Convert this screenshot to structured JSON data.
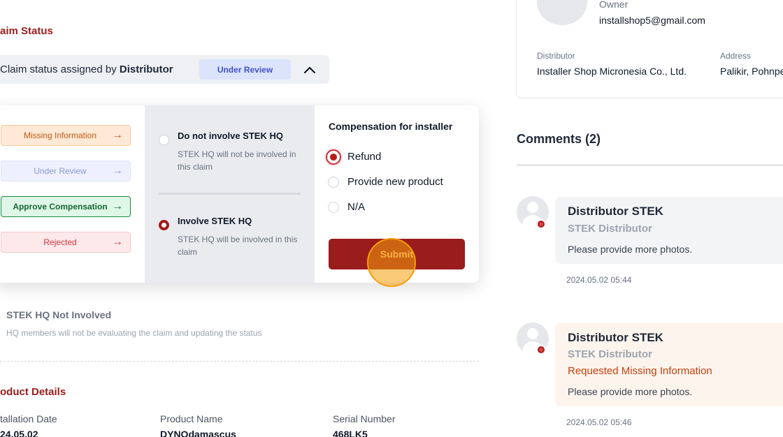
{
  "claim_status": {
    "section_title": "aim Status",
    "assigned_prefix": "Claim status assigned by ",
    "assigned_by": "Distributor",
    "current_status": "Under Review"
  },
  "status_options": [
    {
      "label": "Missing Information"
    },
    {
      "label": "Under Review"
    },
    {
      "label": "Approve Compensation"
    },
    {
      "label": "Rejected"
    }
  ],
  "hq_options": [
    {
      "title": "Do not involve STEK HQ",
      "desc": "STEK HQ will not be involved in this claim",
      "selected": false
    },
    {
      "title": "Involve STEK HQ",
      "desc": "STEK HQ will be involved in this claim",
      "selected": true
    }
  ],
  "compensation": {
    "title": "Compensation for installer",
    "options": [
      {
        "label": "Refund",
        "selected": true
      },
      {
        "label": "Provide new product",
        "selected": false
      },
      {
        "label": "N/A",
        "selected": false
      }
    ],
    "submit_label": "Submit"
  },
  "hq_status": {
    "title": "STEK HQ Not Involved",
    "desc": "HQ members will not be evaluating the claim and updating the status"
  },
  "product_details": {
    "title": "oduct Details",
    "columns": [
      {
        "label": "tallation Date",
        "value": "24.05.02"
      },
      {
        "label": "Product Name",
        "value": "DYNOdamascus"
      },
      {
        "label": "Serial Number",
        "value": "468LK5"
      }
    ]
  },
  "owner_card": {
    "owner_label": "Owner",
    "owner_email": "installshop5@gmail.com",
    "distributor_label": "Distributor",
    "distributor_value": "Installer Shop Micronesia Co., Ltd.",
    "address_label": "Address",
    "address_value": "Palikir, Pohnpe"
  },
  "comments": {
    "title": "Comments (2)",
    "items": [
      {
        "name": "Distributor STEK",
        "role": "STEK Distributor",
        "request": "",
        "text": "Please provide more photos.",
        "time": "2024.05.02 05:44"
      },
      {
        "name": "Distributor STEK",
        "role": "STEK Distributor",
        "request": "Requested Missing Information",
        "text": "Please provide more photos.",
        "time": "2024.05.02 05:46"
      }
    ]
  },
  "colors": {
    "accent": "#9a1c1c",
    "review": "#dbe4fb",
    "approve": "#166534"
  }
}
